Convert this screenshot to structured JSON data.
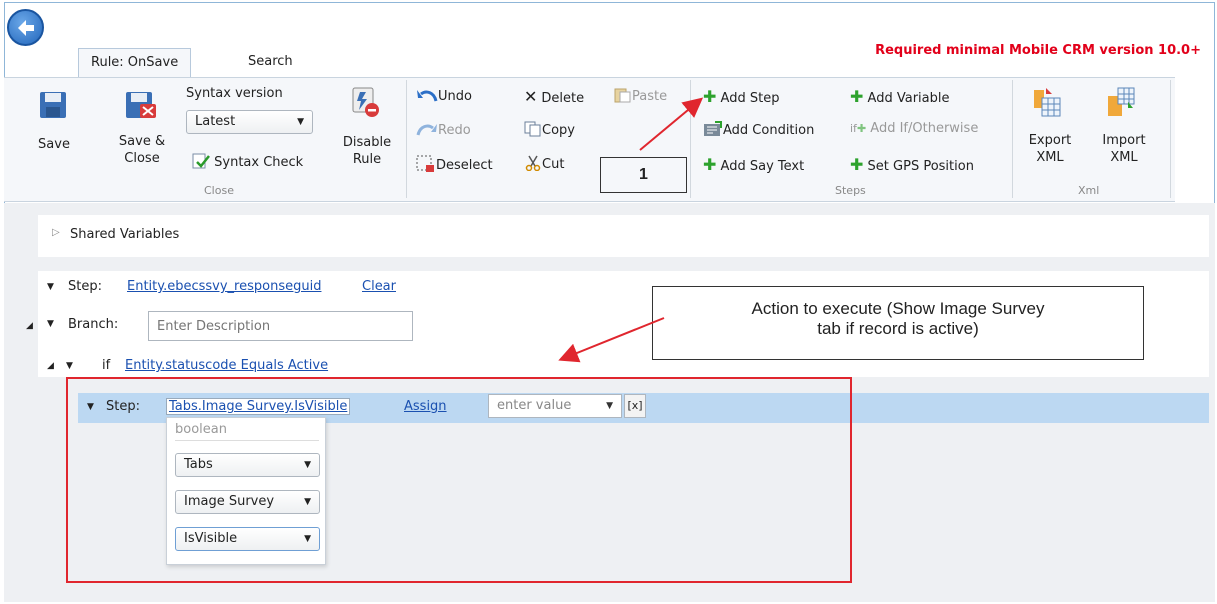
{
  "tabs": {
    "rule": "Rule: OnSave",
    "search": "Search"
  },
  "requirement": "Required minimal Mobile CRM version 10.0+",
  "ribbon": {
    "save": "Save",
    "save_close_1": "Save &",
    "save_close_2": "Close",
    "syntax_version": "Syntax version",
    "syntax_value": "Latest",
    "syntax_check": "Syntax Check",
    "disable_1": "Disable",
    "disable_2": "Rule",
    "group_close": "Close",
    "undo": "Undo",
    "redo": "Redo",
    "deselect": "Deselect",
    "delete": "Delete",
    "copy": "Copy",
    "cut": "Cut",
    "paste": "Paste",
    "add_step": "Add Step",
    "add_condition": "Add Condition",
    "add_say_text": "Add Say Text",
    "add_variable": "Add Variable",
    "add_if_otherwise": "Add If/Otherwise",
    "set_gps": "Set GPS Position",
    "group_steps": "Steps",
    "export_1": "Export",
    "export_2": "XML",
    "import_1": "Import",
    "import_2": "XML",
    "group_xml": "Xml"
  },
  "annotations": {
    "box_number": "1",
    "callout_line1": "Action to execute (Show Image Survey",
    "callout_line2": "tab if record is active)"
  },
  "editor": {
    "shared_variables": "Shared Variables",
    "step_label": "Step:",
    "step1_value": "Entity.ebecssvy_responseguid",
    "clear": "Clear",
    "branch_label": "Branch:",
    "branch_placeholder": "Enter Description",
    "if_label": "if",
    "condition": "Entity.statuscode Equals Active",
    "step2_value": "Tabs.Image Survey.IsVisible",
    "assign": "Assign",
    "value_placeholder": "enter value",
    "x_button": "[x]",
    "type_hint": "boolean",
    "dd1": "Tabs",
    "dd2": "Image Survey",
    "dd3": "IsVisible"
  },
  "colors": {
    "accent_red": "#e2001a",
    "selected_row": "#bcd8f2",
    "link": "#1a50b0"
  }
}
